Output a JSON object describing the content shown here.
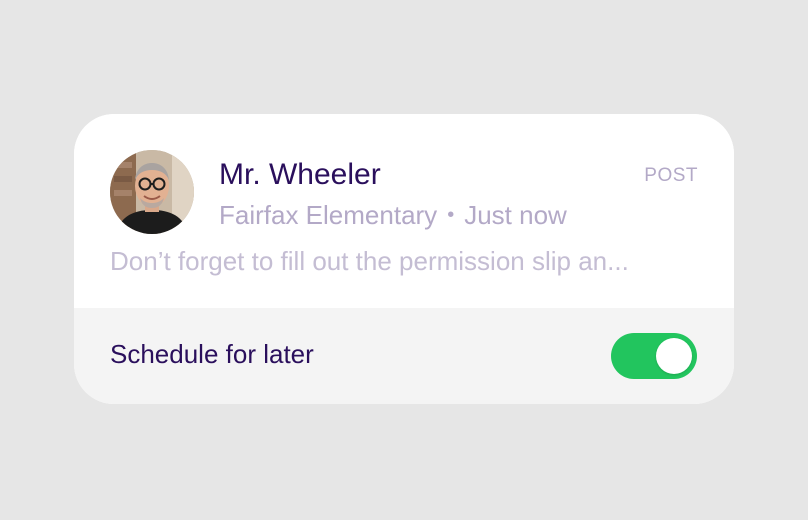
{
  "post": {
    "author_name": "Mr. Wheeler",
    "post_type": "POST",
    "school": "Fairfax Elementary",
    "separator": "•",
    "time": "Just now",
    "preview": "Don’t forget to fill out the permission slip an..."
  },
  "schedule": {
    "label": "Schedule for later",
    "enabled": true
  },
  "colors": {
    "background": "#e6e6e6",
    "primary_text": "#2a0f5c",
    "muted_text": "#b3a9c7",
    "toggle_on": "#22c55e"
  },
  "icons": {
    "avatar": "teacher-avatar-photo"
  }
}
